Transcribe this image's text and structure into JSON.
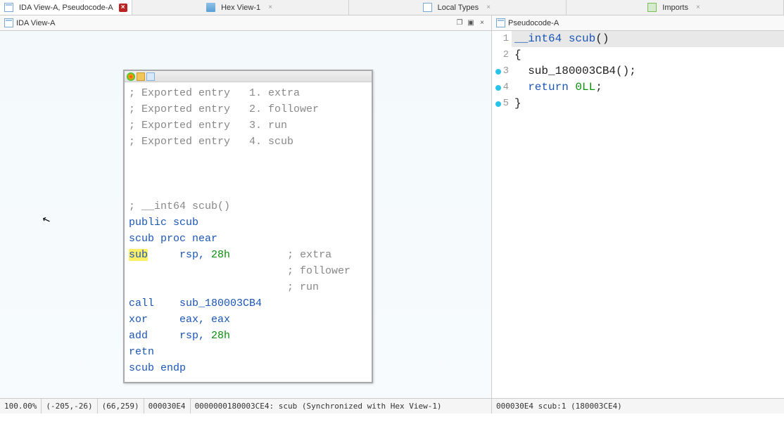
{
  "tabs": [
    {
      "label": "IDA View-A, Pseudocode-A",
      "active": true,
      "closeRed": true
    },
    {
      "label": "Hex View-1",
      "active": false
    },
    {
      "label": "Local Types",
      "active": false
    },
    {
      "label": "Imports",
      "active": false
    }
  ],
  "left": {
    "subheader": "IDA View-A",
    "status": {
      "zoom": "100.00%",
      "coord1": "(-205,-26)",
      "coord2": "(66,259)",
      "offs": "000030E4",
      "addr": "0000000180003CE4:",
      "func": "scub",
      "sync": "(Synchronized with Hex View-1)"
    },
    "disasm": {
      "exported": [
        {
          "n": "1.",
          "name": "extra"
        },
        {
          "n": "2.",
          "name": "follower"
        },
        {
          "n": "3.",
          "name": "run"
        },
        {
          "n": "4.",
          "name": "scub"
        }
      ],
      "sig": "; __int64 scub()",
      "pub": "public scub",
      "procstart": "scub proc near",
      "instr1_op": "sub",
      "instr1_args": "rsp, ",
      "instr1_num": "28h",
      "instr1_c1": "; extra",
      "instr1_c2": "; follower",
      "instr1_c3": "; run",
      "instr2_op": "call",
      "instr2_arg": "sub_180003CB4",
      "instr3_op": "xor",
      "instr3_arg": "eax, eax",
      "instr4_op": "add",
      "instr4_args": "rsp, ",
      "instr4_num": "28h",
      "instr5_op": "retn",
      "procend": "scub endp",
      "exported_prefix": "; Exported entry"
    }
  },
  "right": {
    "subheader": "Pseudocode-A",
    "lines": [
      {
        "n": "1",
        "dot": false,
        "sel": true,
        "segs": [
          {
            "t": "__int64 ",
            "c": "kw2"
          },
          {
            "t": "scub",
            "c": "fn2"
          },
          {
            "t": "()",
            "c": "txt2"
          }
        ]
      },
      {
        "n": "2",
        "dot": false,
        "segs": [
          {
            "t": "{",
            "c": "txt2"
          }
        ]
      },
      {
        "n": "3",
        "dot": true,
        "segs": [
          {
            "t": "  sub_180003CB4();",
            "c": "txt2"
          }
        ]
      },
      {
        "n": "4",
        "dot": true,
        "segs": [
          {
            "t": "  ",
            "c": "txt2"
          },
          {
            "t": "return ",
            "c": "kw2"
          },
          {
            "t": "0LL",
            "c": "num2"
          },
          {
            "t": ";",
            "c": "txt2"
          }
        ]
      },
      {
        "n": "5",
        "dot": true,
        "segs": [
          {
            "t": "}",
            "c": "txt2"
          }
        ]
      }
    ],
    "status": {
      "offs": "000030E4",
      "func": "scub:1",
      "addr": "(180003CE4)"
    }
  }
}
